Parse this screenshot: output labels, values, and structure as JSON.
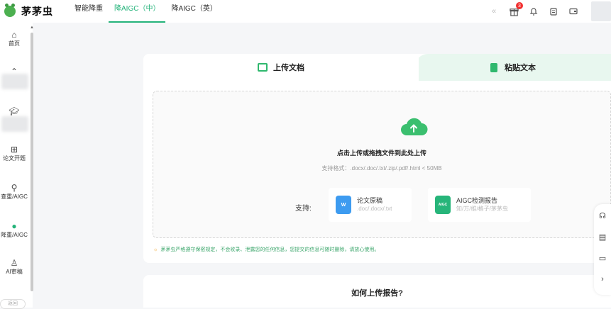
{
  "brand": {
    "name": "茅茅虫"
  },
  "nav": {
    "items": [
      "智能降重",
      "降AIGC（中）",
      "降AIGC（英）"
    ],
    "active_index": 1
  },
  "topbar": {
    "collapse_icon": "«",
    "notification_count": "3"
  },
  "sidebar": {
    "items": [
      {
        "label": "首页",
        "icon": "home-icon"
      },
      {
        "label": "",
        "icon": "hidden-icon"
      },
      {
        "label": "",
        "icon": "graduation-cap-icon"
      },
      {
        "label": "论文开题",
        "icon": "topic-icon"
      },
      {
        "label": "查重/AIGC",
        "icon": "search-icon"
      },
      {
        "label": "降重/AIGC",
        "icon": "leaf-icon"
      },
      {
        "label": "AI审稿",
        "icon": "reviewer-icon"
      }
    ],
    "back_label": "返回"
  },
  "tabs": {
    "upload_label": "上传文档",
    "paste_label": "粘贴文本"
  },
  "upload": {
    "title": "点击上传或拖拽文件到此处上传",
    "formats": "支持格式：.docx/.doc/.txt/.zip/.pdf/.html < 50MB",
    "support_label": "支持:",
    "options": [
      {
        "name": "论文原稿",
        "sub": ".doc/.docx/.txt",
        "icon_text": "W",
        "color": "#3d9bf0"
      },
      {
        "name": "AIGC检测报告",
        "sub": "知/万/维/格子/茅茅虫",
        "icon_text": "AIGC",
        "color": "#27b57a"
      }
    ]
  },
  "notice": "茅茅虫严格遵守保密规定，不会收录、泄露您的任何信息，您提交的信息可随时删除，请放心使用。",
  "howto": {
    "title": "如何上传报告?"
  },
  "colors": {
    "accent": "#24b37a",
    "tab_bg": "#e8f7ef"
  }
}
